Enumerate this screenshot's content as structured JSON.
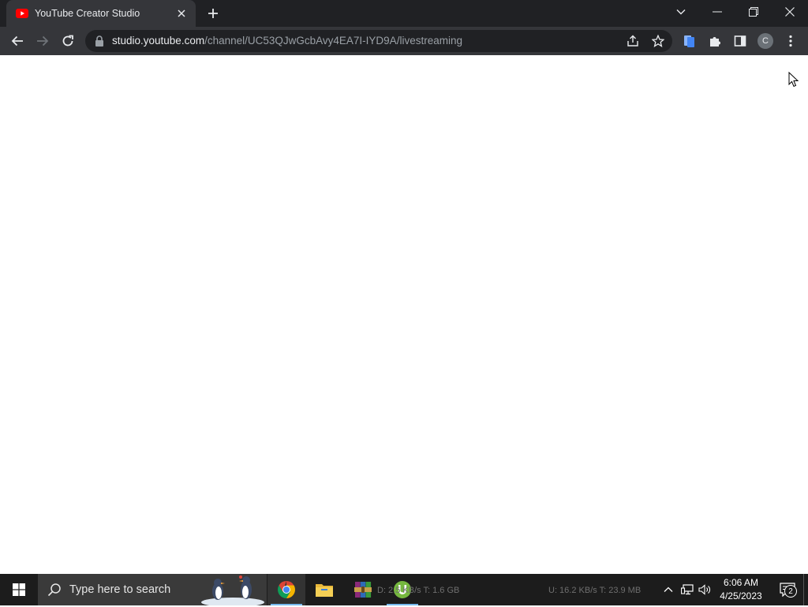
{
  "browser": {
    "tab": {
      "title": "YouTube Creator Studio",
      "favicon": "youtube-icon"
    },
    "address": {
      "host": "studio.youtube.com",
      "path": "/channel/UC53QJwGcbAvy4EA7I-IYD9A/livestreaming"
    },
    "profile_initial": "C",
    "toolbar_icons": [
      "back-icon",
      "forward-icon",
      "reload-icon",
      "share-icon",
      "bookmark-star-icon",
      "extension-docs-icon",
      "extensions-puzzle-icon",
      "side-panel-icon",
      "profile-avatar",
      "menu-kebab-icon"
    ],
    "window_controls": [
      "tab-search-chevron-icon",
      "minimize-icon",
      "restore-icon",
      "close-icon"
    ]
  },
  "taskbar": {
    "search_placeholder": "Type here to search",
    "apps": [
      "chrome-icon",
      "file-explorer-icon",
      "winrar-icon",
      "utorrent-icon"
    ],
    "active_app": "chrome-icon",
    "ghost_text_left": "D: 2.5 KB/s T: 1.6 GB",
    "ghost_text_right": "U: 16.2 KB/s T: 23.9 MB",
    "tray_icons": [
      "show-hidden-icons-chevron",
      "network-icon",
      "volume-icon"
    ],
    "clock": {
      "time": "6:06 AM",
      "date": "4/25/2023"
    },
    "notification_count": "2"
  },
  "colors": {
    "titlebar": "#202124",
    "toolbar": "#35363a",
    "omnibox": "#202124",
    "page": "#ffffff",
    "taskbar": "#1c1c1c",
    "youtube_red": "#ff0000",
    "taskbar_active_underline": "#76b9ed"
  }
}
